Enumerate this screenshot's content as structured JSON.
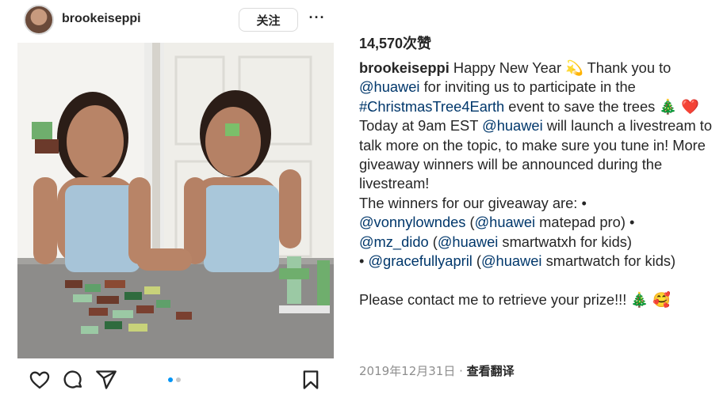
{
  "post": {
    "username": "brookeiseppi",
    "follow_label": "关注",
    "more_label": "···",
    "likes": "14,570次赞",
    "caption": {
      "username": "brookeiseppi",
      "t1": " Happy New Year 💫 Thank you to ",
      "m_huawei_1": "@huawei",
      "t2": " for inviting us to participate in the ",
      "hashtag": "#ChristmasTree4Earth",
      "t3": " event to save the trees 🎄 ❤️ Today at 9am EST ",
      "m_huawei_2": "@huawei",
      "t4": " will launch a livestream to talk more on the topic, to make sure you tune in! More giveaway winners will be announced during the livestream!",
      "winners_intro": "The winners for our giveaway are: •",
      "w1_user": "@vonnylowndes",
      "w1_open": " (",
      "w1_sponsor": "@huawei",
      "w1_prize": " matepad pro) •",
      "w2_user": "@mz_dido",
      "w2_open": " (",
      "w2_sponsor": "@huawei",
      "w2_prize": " smartwatxh for kids)",
      "w3_bullet": "• ",
      "w3_user": "@gracefullyapril",
      "w3_open": " (",
      "w3_sponsor": "@huawei",
      "w3_prize": " smartwatch for kids)",
      "closing": "Please contact me to retrieve your prize!!! 🎄 🥰"
    },
    "date": "2019年12月31日",
    "separator": " · ",
    "translate_label": "查看翻译",
    "carousel": {
      "count": 2,
      "active": 0
    },
    "colors": {
      "link": "#00376b",
      "dot_active": "#0095f6",
      "dot_inactive": "#c7c7c7"
    }
  },
  "icons": [
    "heart-icon",
    "comment-icon",
    "share-icon",
    "bookmark-icon"
  ]
}
